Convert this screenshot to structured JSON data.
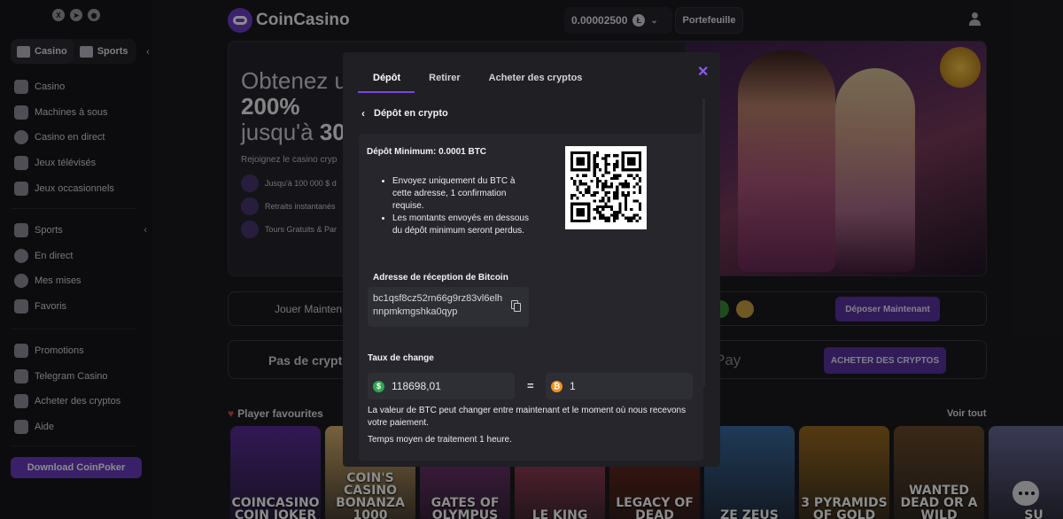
{
  "header": {
    "logo_text": "CoinCasino",
    "balance": "0.00002500",
    "balance_currency_icon": "litecoin-icon",
    "wallet_label": "Portefeuille"
  },
  "sidebar": {
    "mode_tabs": [
      {
        "label": "Casino",
        "icon": "casino-icon",
        "active": true
      },
      {
        "label": "Sports",
        "icon": "sports-icon",
        "active": false
      }
    ],
    "casino_items": [
      {
        "label": "Casino",
        "icon": "cards-icon"
      },
      {
        "label": "Machines à sous",
        "icon": "slot-machine-icon"
      },
      {
        "label": "Casino en direct",
        "icon": "live-casino-icon"
      },
      {
        "label": "Jeux télévisés",
        "icon": "tv-games-icon"
      },
      {
        "label": "Jeux occasionnels",
        "icon": "rocket-icon"
      }
    ],
    "sports_items": [
      {
        "label": "Sports",
        "icon": "sports-icon"
      },
      {
        "label": "En direct",
        "icon": "play-icon"
      },
      {
        "label": "Mes mises",
        "icon": "bets-icon"
      },
      {
        "label": "Favoris",
        "icon": "star-icon"
      }
    ],
    "other_items": [
      {
        "label": "Promotions",
        "icon": "gift-icon"
      },
      {
        "label": "Telegram Casino",
        "icon": "telegram-icon"
      },
      {
        "label": "Acheter des cryptos",
        "icon": "cart-icon"
      },
      {
        "label": "Aide",
        "icon": "help-icon"
      }
    ],
    "download_label": "Download CoinPoker"
  },
  "hero": {
    "title_line1": "Obtenez u",
    "title_line2": "200%",
    "title_line3_a": "jusqu'à ",
    "title_line3_b": "30",
    "subtitle": "Rejoignez le casino cryp",
    "features": [
      "Jusqu'à 100 000 $ d",
      "Retraits instantanés",
      "Tours Gratuits & Par"
    ]
  },
  "banners": {
    "row1_text": "Jouer Mainten",
    "row1_button": "Déposer Maintenant",
    "row2_text": "Pas de crypto",
    "row2_pay": "Pay",
    "row2_button": "ACHETER DES CRYPTOS"
  },
  "favourites": {
    "title": "Player favourites",
    "see_all": "Voir tout",
    "games": [
      {
        "name": "COINCASINO COIN JOKER",
        "color": "#5a2d9a"
      },
      {
        "name": "COIN'S CASINO BONANZA 1000",
        "color": "#d8b070"
      },
      {
        "name": "GATES OF OLYMPUS",
        "color": "#8a3a8a"
      },
      {
        "name": "LE KING",
        "color": "#c04a6a"
      },
      {
        "name": "LEGACY OF DEAD",
        "color": "#7a2a1a"
      },
      {
        "name": "ZE ZEUS",
        "color": "#3a6aa0"
      },
      {
        "name": "3 PYRAMIDS OF GOLD",
        "color": "#9a6a20"
      },
      {
        "name": "WANTED DEAD OR A WILD",
        "color": "#6a4a2a"
      },
      {
        "name": "SU",
        "color": "#6a6a9a"
      }
    ]
  },
  "modal": {
    "tabs": [
      "Dépôt",
      "Retirer",
      "Acheter des cryptos"
    ],
    "active_tab": 0,
    "back_label": "Dépôt en crypto",
    "min_deposit": "Dépôt Minimum: 0.0001 BTC",
    "instructions": [
      "Envoyez uniquement du BTC à cette adresse, 1 confirmation requise.",
      "Les montants envoyés en dessous du dépôt minimum seront perdus."
    ],
    "address_label": "Adresse de réception de Bitcoin",
    "address": "bc1qsf8cz52rn66g9rz83vl6elhnnpmkmgshka0qyp",
    "rate_label": "Taux de change",
    "usd_value": "118698,01",
    "usd_symbol": "$",
    "btc_value": "1",
    "btc_symbol": "₿",
    "equals": "=",
    "rate_note": "La valeur de BTC peut changer entre maintenant et le moment où nous recevons votre paiement.",
    "processing_time": "Temps moyen de traitement 1 heure.",
    "colors": {
      "accent": "#7b4ad6",
      "usd": "#2fa84f",
      "btc": "#f2921b"
    }
  }
}
